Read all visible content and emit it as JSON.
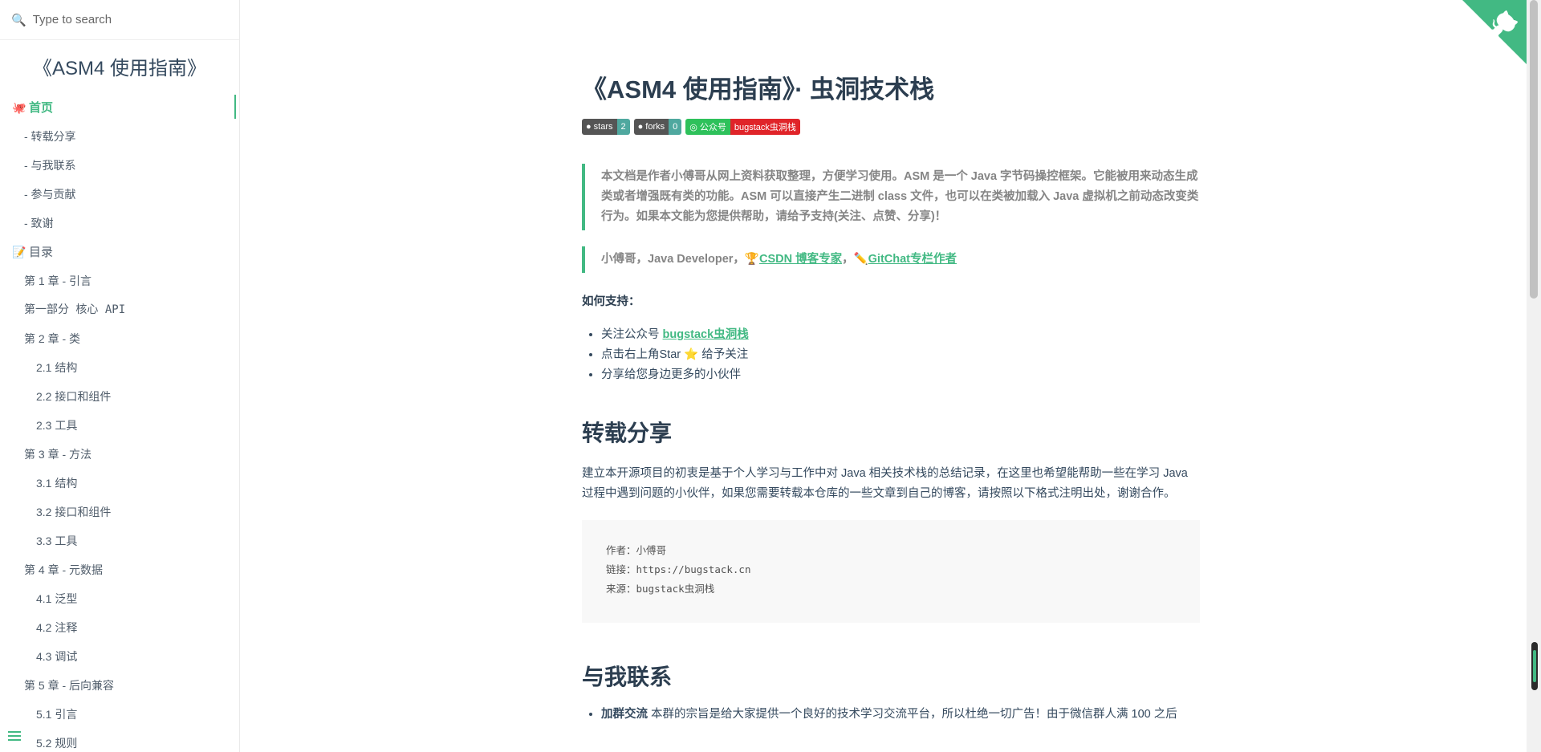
{
  "search": {
    "placeholder": "Type to search"
  },
  "sidebar": {
    "app_name": "《ASM4 使用指南》",
    "items": [
      {
        "label": "首页",
        "level": 0,
        "emoji": "🐙",
        "active": true
      },
      {
        "label": "- 转载分享",
        "level": 1
      },
      {
        "label": "- 与我联系",
        "level": 1
      },
      {
        "label": "- 参与贡献",
        "level": 1
      },
      {
        "label": "- 致谢",
        "level": 1
      },
      {
        "label": "目录",
        "level": 0,
        "emoji": "📝"
      },
      {
        "label": "第 1 章 - 引言",
        "level": 1
      },
      {
        "label": "第一部分 核心 API",
        "level": 1,
        "mono": true
      },
      {
        "label": "第 2 章 - 类",
        "level": 1
      },
      {
        "label": "2.1 结构",
        "level": 2
      },
      {
        "label": "2.2 接口和组件",
        "level": 2
      },
      {
        "label": "2.3 工具",
        "level": 2
      },
      {
        "label": "第 3 章 - 方法",
        "level": 1
      },
      {
        "label": "3.1 结构",
        "level": 2
      },
      {
        "label": "3.2 接口和组件",
        "level": 2
      },
      {
        "label": "3.3 工具",
        "level": 2
      },
      {
        "label": "第 4 章 - 元数据",
        "level": 1
      },
      {
        "label": "4.1 泛型",
        "level": 2
      },
      {
        "label": "4.2 注释",
        "level": 2
      },
      {
        "label": "4.3 调试",
        "level": 2
      },
      {
        "label": "第 5 章 - 后向兼容",
        "level": 1
      },
      {
        "label": "5.1 引言",
        "level": 2
      },
      {
        "label": "5.2 规则",
        "level": 2
      }
    ]
  },
  "main": {
    "title": "《ASM4 使用指南》· 虫洞技术栈",
    "badges": {
      "stars_label": "stars",
      "stars_count": "2",
      "forks_label": "forks",
      "forks_count": "0",
      "wechat_label": "公众号",
      "wechat_value": "bugstack虫洞栈"
    },
    "intro": "本文档是作者小傅哥从网上资料获取整理，方便学习使用。ASM 是一个 Java 字节码操控框架。它能被用来动态生成类或者增强既有类的功能。ASM 可以直接产生二进制 class 文件，也可以在类被加载入 Java 虚拟机之前动态改变类行为。如果本文能为您提供帮助，请给予支持(关注、点赞、分享)！",
    "author": {
      "prefix": "小傅哥，Java Developer，",
      "csdn_emoji": "🏆",
      "csdn_link": "CSDN 博客专家",
      "sep": "，",
      "gitchat_emoji": "✏️",
      "gitchat_link": "GitChat专栏作者"
    },
    "how_support": "如何支持：",
    "support": {
      "follow_prefix": "关注公众号 ",
      "follow_link": "bugstack虫洞栈",
      "star_prefix": "点击右上角Star ",
      "star_emoji": "⭐",
      "star_suffix": " 给予关注",
      "share": "分享给您身边更多的小伙伴"
    },
    "repost_heading": "转载分享",
    "repost_text": "建立本开源项目的初衷是基于个人学习与工作中对 Java 相关技术栈的总结记录，在这里也希望能帮助一些在学习 Java 过程中遇到问题的小伙伴，如果您需要转载本仓库的一些文章到自己的博客，请按照以下格式注明出处，谢谢合作。",
    "code_lines": [
      "作者：小傅哥",
      "链接：https://bugstack.cn",
      "来源：bugstack虫洞栈"
    ],
    "contact_heading": "与我联系",
    "contact_bold": "加群交流",
    "contact_text": " 本群的宗旨是给大家提供一个良好的技术学习交流平台，所以杜绝一切广告！由于微信群人满 100 之后"
  },
  "colors": {
    "accent": "#42b983",
    "heading": "#2c3e50",
    "text": "#34495e"
  }
}
